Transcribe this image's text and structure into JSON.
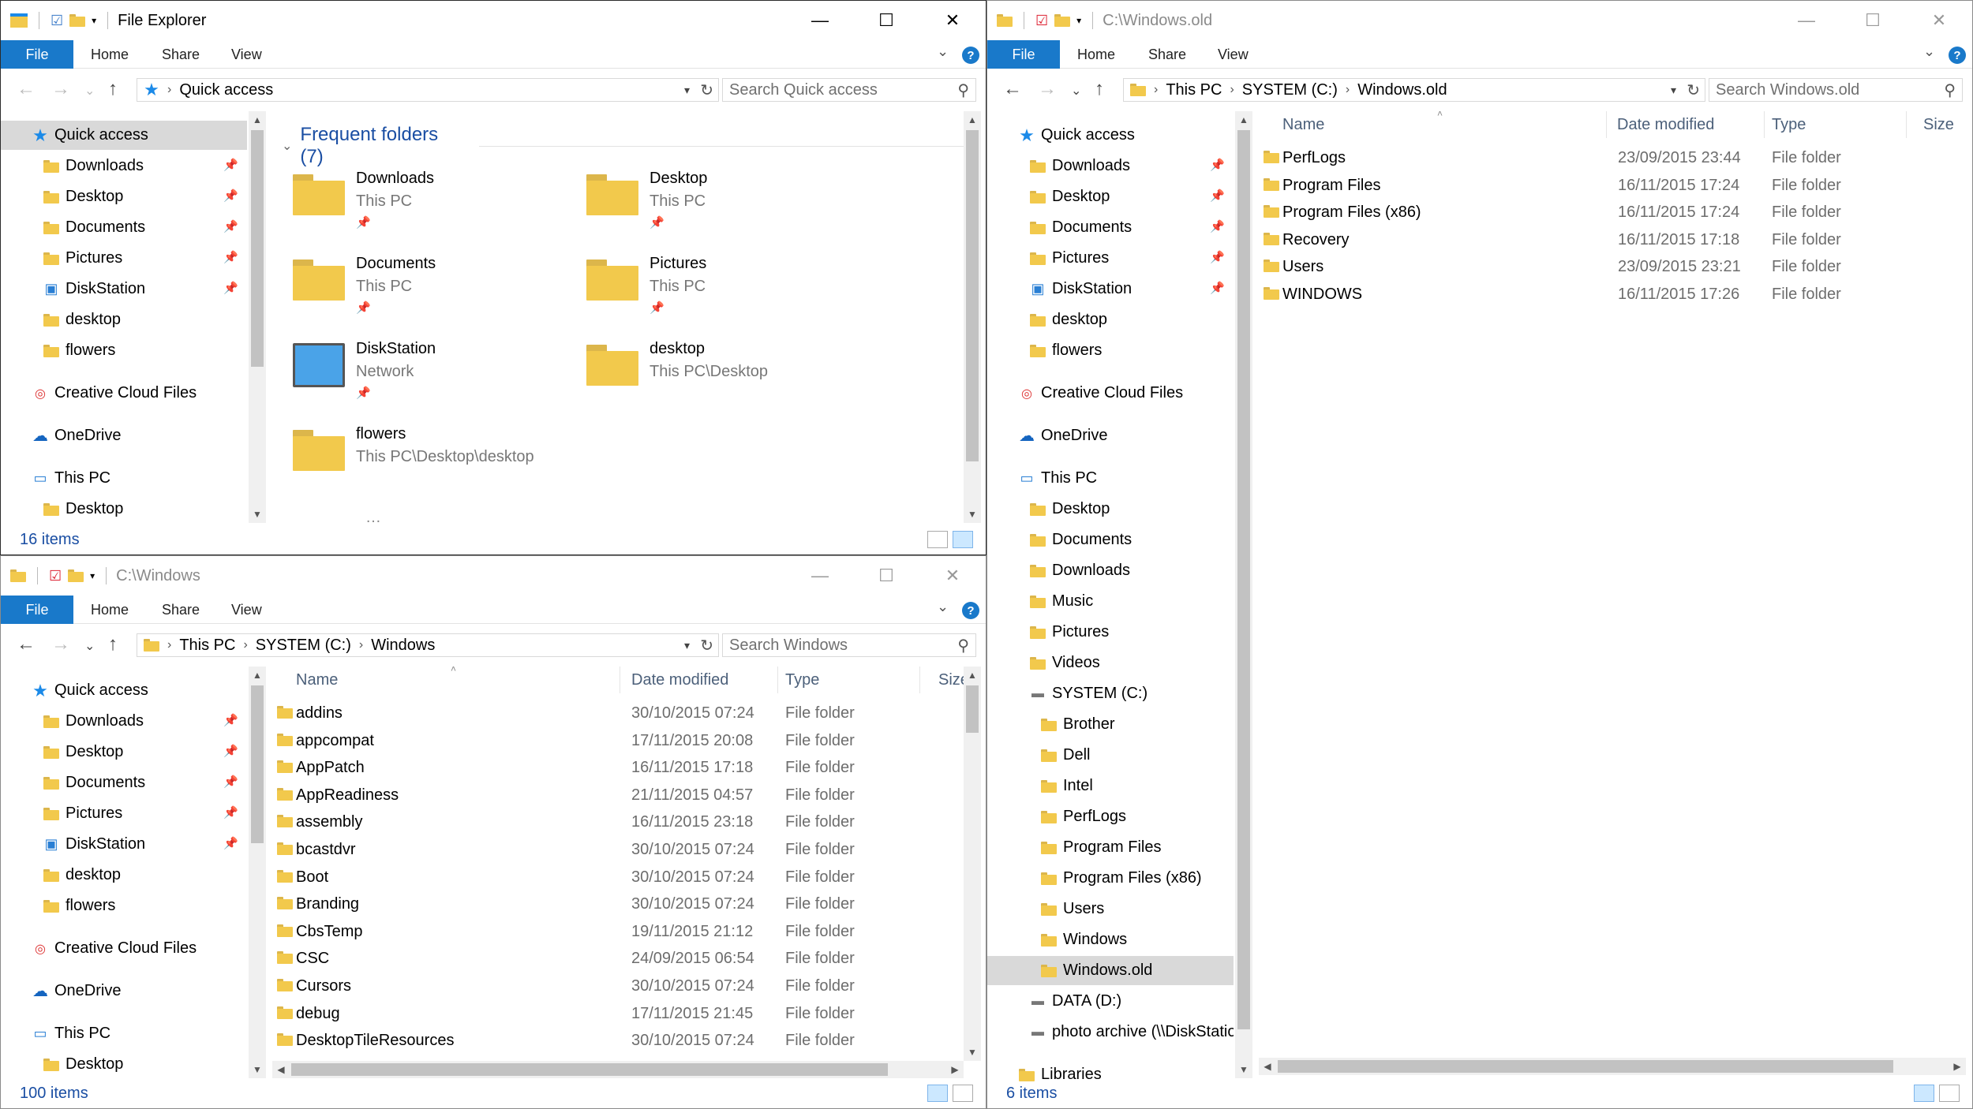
{
  "w1": {
    "title": "File Explorer",
    "tabs": [
      "File",
      "Home",
      "Share",
      "View"
    ],
    "address": [
      "Quick access"
    ],
    "search_placeholder": "Search Quick access",
    "nav": [
      {
        "label": "Quick access",
        "icon": "star",
        "sel": true
      },
      {
        "label": "Downloads",
        "icon": "folder",
        "pin": true,
        "indent": 1
      },
      {
        "label": "Desktop",
        "icon": "folder",
        "pin": true,
        "indent": 1
      },
      {
        "label": "Documents",
        "icon": "folder",
        "pin": true,
        "indent": 1
      },
      {
        "label": "Pictures",
        "icon": "folder",
        "pin": true,
        "indent": 1
      },
      {
        "label": "DiskStation",
        "icon": "network",
        "pin": true,
        "indent": 1
      },
      {
        "label": "desktop",
        "icon": "folder",
        "indent": 1
      },
      {
        "label": "flowers",
        "icon": "folder",
        "indent": 1
      },
      {
        "label": "Creative Cloud Files",
        "icon": "cc",
        "gap": true
      },
      {
        "label": "OneDrive",
        "icon": "cloud",
        "gap": true
      },
      {
        "label": "This PC",
        "icon": "pc",
        "gap": true
      },
      {
        "label": "Desktop",
        "icon": "folder",
        "indent": 1
      }
    ],
    "section": "Frequent folders (7)",
    "tiles": [
      {
        "name": "Downloads",
        "sub": "This PC",
        "pin": true
      },
      {
        "name": "Desktop",
        "sub": "This PC",
        "pin": true
      },
      {
        "name": "Documents",
        "sub": "This PC",
        "pin": true
      },
      {
        "name": "Pictures",
        "sub": "This PC",
        "pin": true
      },
      {
        "name": "DiskStation",
        "sub": "Network",
        "pin": true
      },
      {
        "name": "desktop",
        "sub": "This PC\\Desktop",
        "pin": false
      },
      {
        "name": "flowers",
        "sub": "This PC\\Desktop\\desktop",
        "pin": false
      }
    ],
    "status": "16 items"
  },
  "w2": {
    "title": "C:\\Windows",
    "tabs": [
      "File",
      "Home",
      "Share",
      "View"
    ],
    "address": [
      "This PC",
      "SYSTEM (C:)",
      "Windows"
    ],
    "search_placeholder": "Search Windows",
    "nav": [
      {
        "label": "Quick access",
        "icon": "star"
      },
      {
        "label": "Downloads",
        "icon": "folder",
        "pin": true,
        "indent": 1
      },
      {
        "label": "Desktop",
        "icon": "folder",
        "pin": true,
        "indent": 1
      },
      {
        "label": "Documents",
        "icon": "folder",
        "pin": true,
        "indent": 1
      },
      {
        "label": "Pictures",
        "icon": "folder",
        "pin": true,
        "indent": 1
      },
      {
        "label": "DiskStation",
        "icon": "network",
        "pin": true,
        "indent": 1
      },
      {
        "label": "desktop",
        "icon": "folder",
        "indent": 1
      },
      {
        "label": "flowers",
        "icon": "folder",
        "indent": 1
      },
      {
        "label": "Creative Cloud Files",
        "icon": "cc",
        "gap": true
      },
      {
        "label": "OneDrive",
        "icon": "cloud",
        "gap": true
      },
      {
        "label": "This PC",
        "icon": "pc",
        "gap": true
      },
      {
        "label": "Desktop",
        "icon": "folder",
        "indent": 1
      }
    ],
    "columns": [
      "Name",
      "Date modified",
      "Type",
      "Size"
    ],
    "rows": [
      [
        "addins",
        "30/10/2015 07:24",
        "File folder"
      ],
      [
        "appcompat",
        "17/11/2015 20:08",
        "File folder"
      ],
      [
        "AppPatch",
        "16/11/2015 17:18",
        "File folder"
      ],
      [
        "AppReadiness",
        "21/11/2015 04:57",
        "File folder"
      ],
      [
        "assembly",
        "16/11/2015 23:18",
        "File folder"
      ],
      [
        "bcastdvr",
        "30/10/2015 07:24",
        "File folder"
      ],
      [
        "Boot",
        "30/10/2015 07:24",
        "File folder"
      ],
      [
        "Branding",
        "30/10/2015 07:24",
        "File folder"
      ],
      [
        "CbsTemp",
        "19/11/2015 21:12",
        "File folder"
      ],
      [
        "CSC",
        "24/09/2015 06:54",
        "File folder"
      ],
      [
        "Cursors",
        "30/10/2015 07:24",
        "File folder"
      ],
      [
        "debug",
        "17/11/2015 21:45",
        "File folder"
      ],
      [
        "DesktopTileResources",
        "30/10/2015 07:24",
        "File folder"
      ]
    ],
    "status": "100 items"
  },
  "w3": {
    "title": "C:\\Windows.old",
    "tabs": [
      "File",
      "Home",
      "Share",
      "View"
    ],
    "address": [
      "This PC",
      "SYSTEM (C:)",
      "Windows.old"
    ],
    "search_placeholder": "Search Windows.old",
    "nav": [
      {
        "label": "Quick access",
        "icon": "star"
      },
      {
        "label": "Downloads",
        "icon": "folder",
        "pin": true,
        "indent": 1
      },
      {
        "label": "Desktop",
        "icon": "folder",
        "pin": true,
        "indent": 1
      },
      {
        "label": "Documents",
        "icon": "folder",
        "pin": true,
        "indent": 1
      },
      {
        "label": "Pictures",
        "icon": "folder",
        "pin": true,
        "indent": 1
      },
      {
        "label": "DiskStation",
        "icon": "network",
        "pin": true,
        "indent": 1
      },
      {
        "label": "desktop",
        "icon": "folder",
        "indent": 1
      },
      {
        "label": "flowers",
        "icon": "folder",
        "indent": 1
      },
      {
        "label": "Creative Cloud Files",
        "icon": "cc",
        "gap": true
      },
      {
        "label": "OneDrive",
        "icon": "cloud",
        "gap": true
      },
      {
        "label": "This PC",
        "icon": "pc",
        "gap": true
      },
      {
        "label": "Desktop",
        "icon": "folder",
        "indent": 1
      },
      {
        "label": "Documents",
        "icon": "folder",
        "indent": 1
      },
      {
        "label": "Downloads",
        "icon": "folder",
        "indent": 1
      },
      {
        "label": "Music",
        "icon": "folder",
        "indent": 1
      },
      {
        "label": "Pictures",
        "icon": "folder",
        "indent": 1
      },
      {
        "label": "Videos",
        "icon": "folder",
        "indent": 1
      },
      {
        "label": "SYSTEM (C:)",
        "icon": "drive",
        "indent": 1
      },
      {
        "label": "Brother",
        "icon": "folder",
        "indent": 2
      },
      {
        "label": "Dell",
        "icon": "folder",
        "indent": 2
      },
      {
        "label": "Intel",
        "icon": "folder",
        "indent": 2
      },
      {
        "label": "PerfLogs",
        "icon": "folder",
        "indent": 2
      },
      {
        "label": "Program Files",
        "icon": "folder",
        "indent": 2
      },
      {
        "label": "Program Files (x86)",
        "icon": "folder",
        "indent": 2
      },
      {
        "label": "Users",
        "icon": "folder",
        "indent": 2
      },
      {
        "label": "Windows",
        "icon": "folder",
        "indent": 2
      },
      {
        "label": "Windows.old",
        "icon": "folder",
        "indent": 2,
        "sel": true
      },
      {
        "label": "DATA (D:)",
        "icon": "drive",
        "indent": 1
      },
      {
        "label": "photo archive (\\\\DiskStatio",
        "icon": "drive",
        "indent": 1
      },
      {
        "label": "Libraries",
        "icon": "folder",
        "gap": true
      }
    ],
    "columns": [
      "Name",
      "Date modified",
      "Type",
      "Size"
    ],
    "rows": [
      [
        "PerfLogs",
        "23/09/2015 23:44",
        "File folder"
      ],
      [
        "Program Files",
        "16/11/2015 17:24",
        "File folder"
      ],
      [
        "Program Files (x86)",
        "16/11/2015 17:24",
        "File folder"
      ],
      [
        "Recovery",
        "16/11/2015 17:18",
        "File folder"
      ],
      [
        "Users",
        "23/09/2015 23:21",
        "File folder"
      ],
      [
        "WINDOWS",
        "16/11/2015 17:26",
        "File folder"
      ]
    ],
    "status": "6 items"
  }
}
